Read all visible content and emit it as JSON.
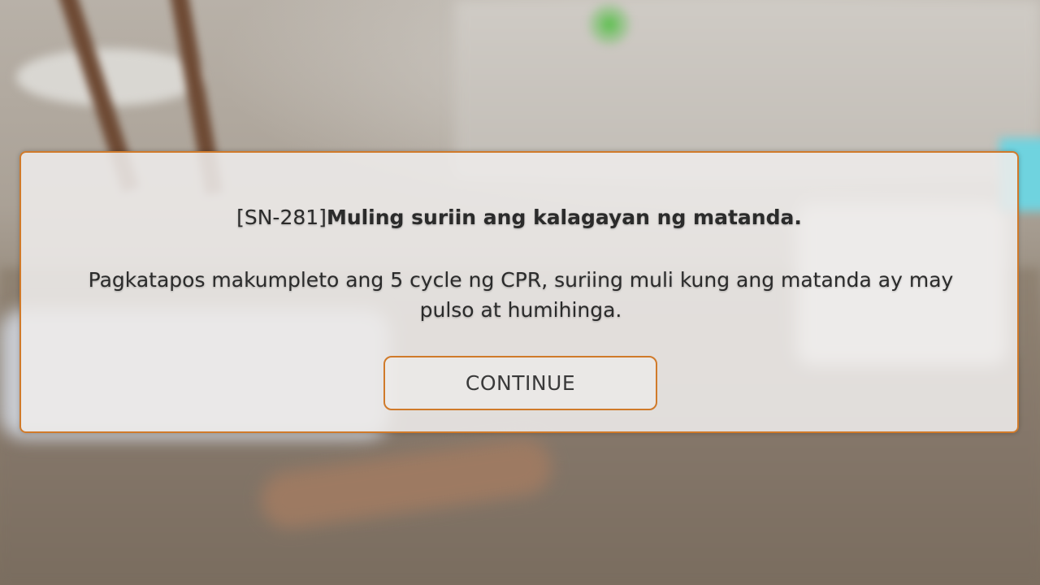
{
  "dialog": {
    "code": "[SN-281]",
    "heading": "Muling suriin ang kalagayan ng matanda.",
    "body": "Pagkatapos makumpleto ang 5 cycle ng CPR, suriing muli kung ang matanda ay may pulso at humihinga.",
    "continue_label": "CONTINUE"
  },
  "colors": {
    "accent_border": "#d07a2a",
    "panel_background": "#eeecea",
    "text": "#2b2b2b"
  }
}
